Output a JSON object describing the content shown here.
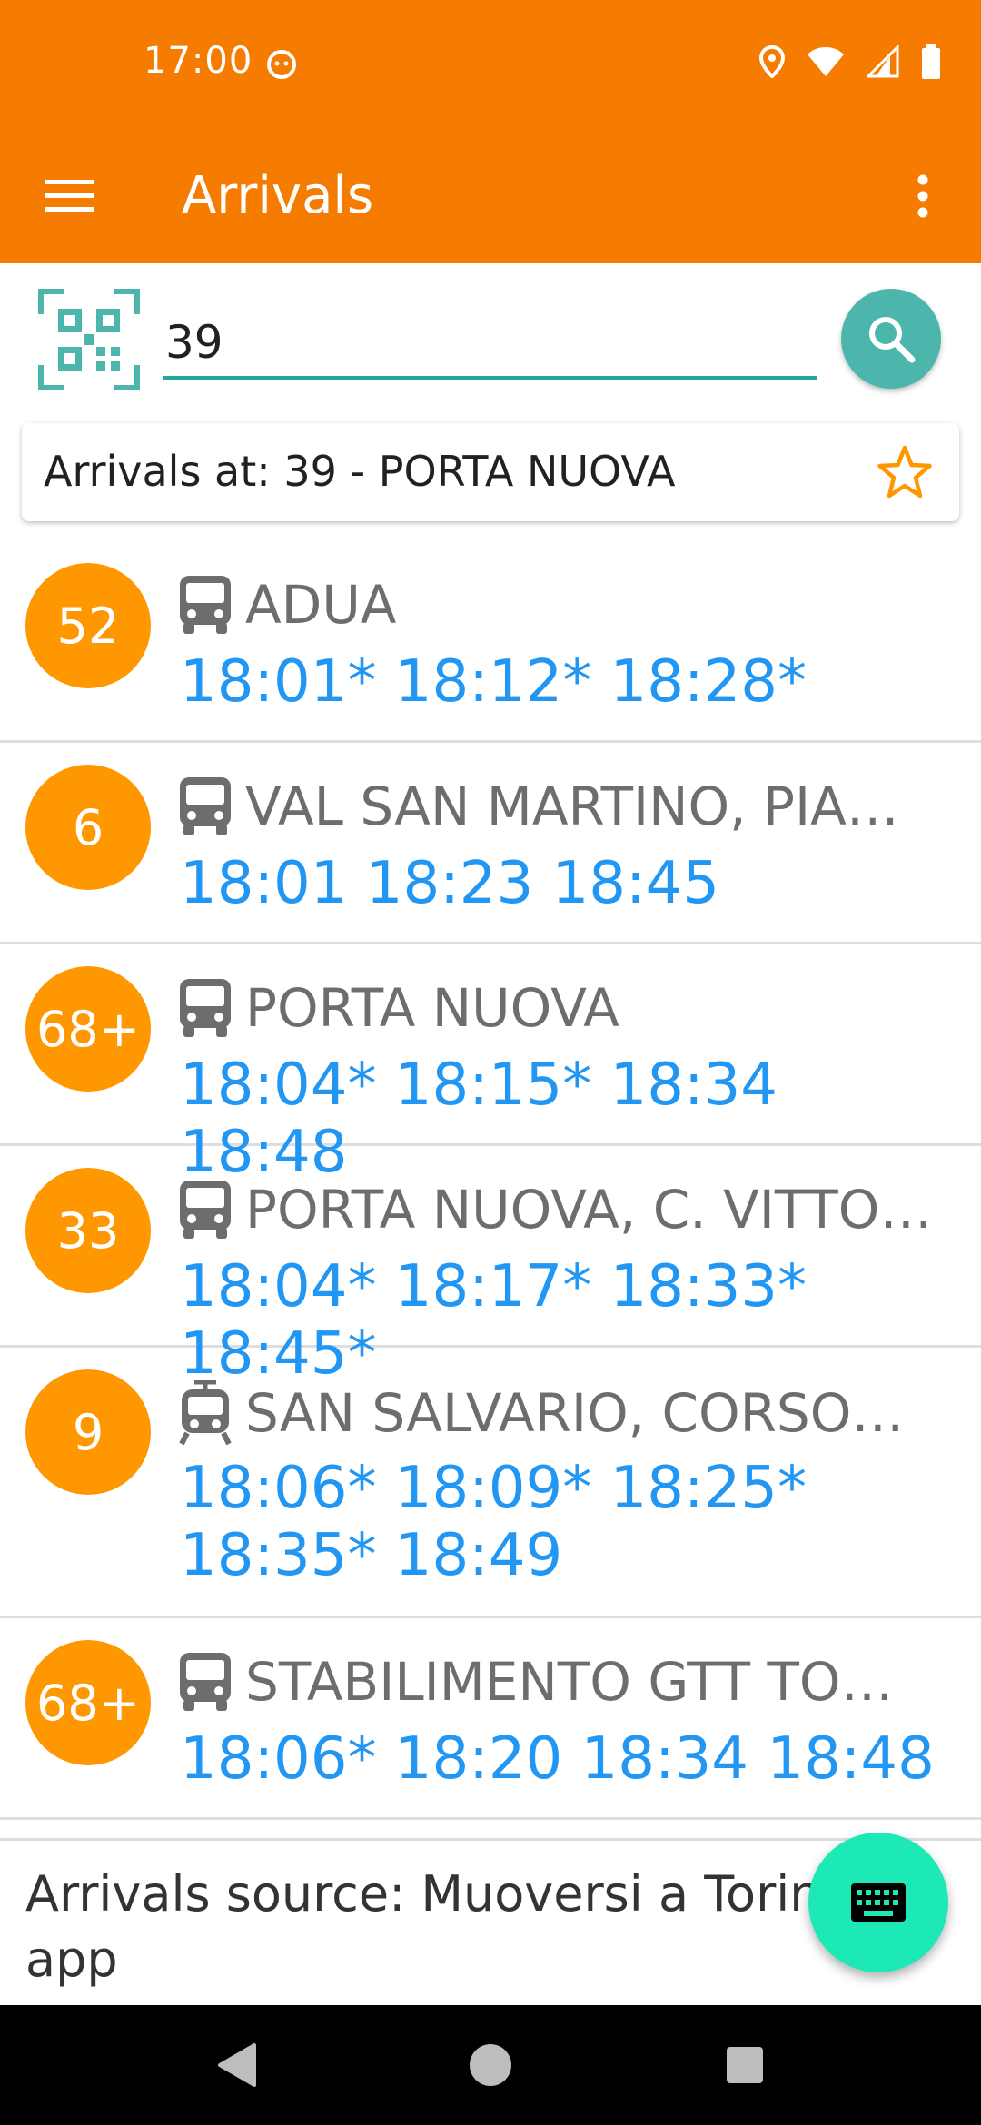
{
  "status_bar": {
    "time": "17:00"
  },
  "app_bar": {
    "title": "Arrivals"
  },
  "search": {
    "value": "39"
  },
  "stop": {
    "label": "Arrivals at: 39 - PORTA NUOVA"
  },
  "arrivals": [
    {
      "line": "52",
      "destination": "ADUA",
      "times": "18:01* 18:12* 18:28*",
      "vehicle": "bus"
    },
    {
      "line": "6",
      "destination": "VAL SAN MARTINO, PIA…",
      "times": "18:01 18:23 18:45",
      "vehicle": "bus"
    },
    {
      "line": "68+",
      "destination": "PORTA NUOVA",
      "times": "18:04* 18:15* 18:34 18:48",
      "vehicle": "bus"
    },
    {
      "line": "33",
      "destination": "PORTA NUOVA, C. VITTO…",
      "times": "18:04* 18:17* 18:33* 18:45*",
      "vehicle": "bus"
    },
    {
      "line": "9",
      "destination": "SAN SALVARIO, CORSO…",
      "times": "18:06* 18:09* 18:25* 18:35* 18:49",
      "vehicle": "tram"
    },
    {
      "line": "68+",
      "destination": "STABILIMENTO GTT TO…",
      "times": "18:06* 18:20 18:34 18:48",
      "vehicle": "bus"
    }
  ],
  "footer": {
    "source_text": "Arrivals source: Muoversi a Torino app"
  },
  "colors": {
    "primary": "#f57c00",
    "badge": "#ff9800",
    "accent_teal": "#4db6ac",
    "times_blue": "#2196f3",
    "fab": "#1de9b6"
  },
  "icons": {
    "menu": "hamburger-menu-icon",
    "overflow": "more-vert-icon",
    "qr": "qr-code-scanner-icon",
    "search": "search-icon",
    "favorite": "star-outline-icon",
    "bus": "bus-icon",
    "tram": "tram-icon",
    "keyboard": "keyboard-icon"
  }
}
